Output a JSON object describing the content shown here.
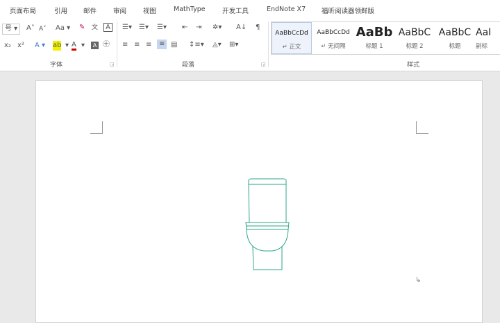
{
  "tabs": [
    "页面布局",
    "引用",
    "邮件",
    "审阅",
    "视图",
    "MathType",
    "开发工具",
    "EndNote X7",
    "福昕阅读器领鲜版"
  ],
  "font_group": {
    "label": "字体",
    "icons": [
      "font-size-dropdown",
      "grow-font",
      "shrink-font",
      "change-case",
      "clear-format",
      "phonetic-guide",
      "char-border",
      "subscript",
      "superscript",
      "text-effects",
      "highlight",
      "font-color",
      "char-shading",
      "enclose-char"
    ]
  },
  "paragraph_group": {
    "label": "段落"
  },
  "styles_group": {
    "label": "样式",
    "items": [
      {
        "preview": "AaBbCcDd",
        "name": "↵ 正文",
        "selected": true
      },
      {
        "preview": "AaBbCcDd",
        "name": "↵ 无间隔"
      },
      {
        "preview": "AaBb",
        "name": "标题 1"
      },
      {
        "preview": "AaBbC",
        "name": "标题 2"
      },
      {
        "preview": "AaBbC",
        "name": "标题"
      },
      {
        "preview": "AaI",
        "name": "副标"
      }
    ]
  },
  "ribbon_text": {
    "font_size": "号",
    "grow": "A",
    "shrink": "A",
    "case": "Aa",
    "sub": "x₂",
    "sup": "x²",
    "sort": "A↓"
  },
  "colors": {
    "drawing": "#2aa58a",
    "highlight": "#f2f200",
    "font_color": "#d00000"
  }
}
